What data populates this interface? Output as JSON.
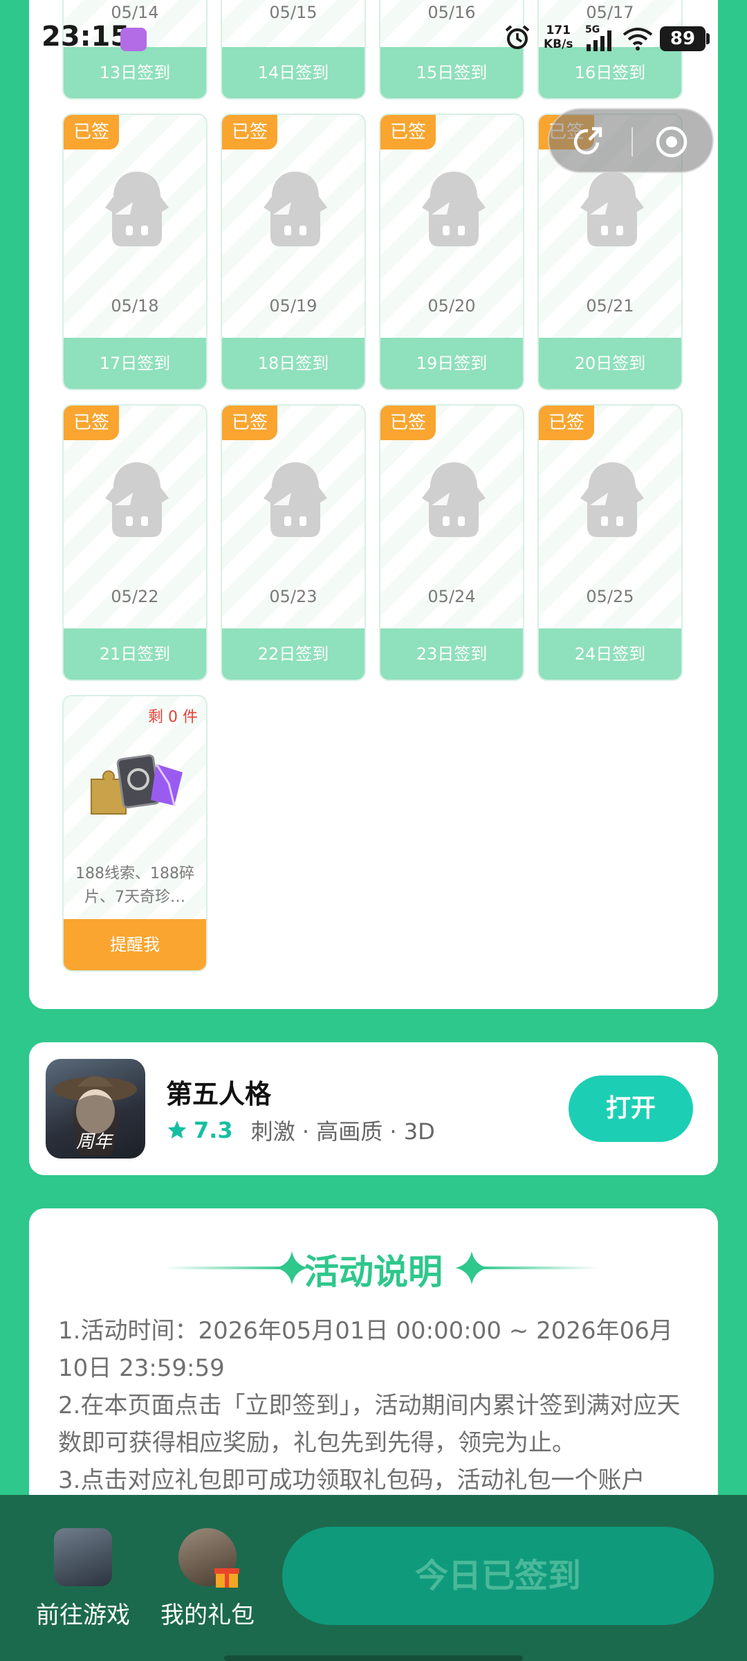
{
  "status": {
    "time": "23:15",
    "net_speed_value": "171",
    "net_speed_unit": "KB/s",
    "network": "5G",
    "battery": "89"
  },
  "top_row": [
    {
      "date": "05/14",
      "label": "13日签到"
    },
    {
      "date": "05/15",
      "label": "14日签到"
    },
    {
      "date": "05/16",
      "label": "15日签到"
    },
    {
      "date": "05/17",
      "label": "16日签到"
    }
  ],
  "signed_badge": "已签",
  "rows": [
    [
      {
        "date": "05/18",
        "label": "17日签到"
      },
      {
        "date": "05/19",
        "label": "18日签到"
      },
      {
        "date": "05/20",
        "label": "19日签到"
      },
      {
        "date": "05/21",
        "label": "20日签到"
      }
    ],
    [
      {
        "date": "05/22",
        "label": "21日签到"
      },
      {
        "date": "05/23",
        "label": "22日签到"
      },
      {
        "date": "05/24",
        "label": "23日签到"
      },
      {
        "date": "05/25",
        "label": "24日签到"
      }
    ]
  ],
  "reward": {
    "remaining": "剩 0 件",
    "desc": "188线索、188碎片、7天奇珍…",
    "remind": "提醒我"
  },
  "game": {
    "name": "第五人格",
    "icon_tag": "周年",
    "score": "7.3",
    "tags": "刺激 · 高画质 · 3D",
    "open": "打开"
  },
  "rules": {
    "title": "活动说明",
    "lines": [
      "1.活动时间：2026年05月01日 00:00:00 ~ 2026年06月10日 23:59:59",
      "2.在本页面点击「立即签到」，活动期间内累计签到满对应天数即可获得相应奖励，礼包先到先得，领完为止。",
      "3.点击对应礼包即可成功领取礼包码，活动礼包一个账户"
    ]
  },
  "bottom": {
    "go_game": "前往游戏",
    "my_gift": "我的礼包",
    "checked_today": "今日已签到"
  }
}
